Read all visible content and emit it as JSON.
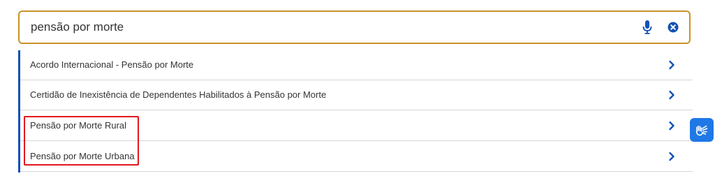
{
  "search": {
    "value": "pensão por morte",
    "mic_icon": "microphone-icon",
    "clear_icon": "clear-circle-x-icon"
  },
  "results": [
    {
      "label": "Acordo Internacional - Pensão por Morte"
    },
    {
      "label": "Certidão de Inexistência de Dependentes Habilitados à Pensão por Morte"
    },
    {
      "label": "Pensão por Morte Rural"
    },
    {
      "label": "Pensão por Morte Urbana"
    }
  ],
  "colors": {
    "search_border": "#c8932b",
    "accent_blue": "#1351b4",
    "highlight_red": "#e3161b",
    "vlibras_blue": "#1f78e6"
  },
  "accessibility_widget": {
    "icon": "sign-language-hands-icon"
  }
}
